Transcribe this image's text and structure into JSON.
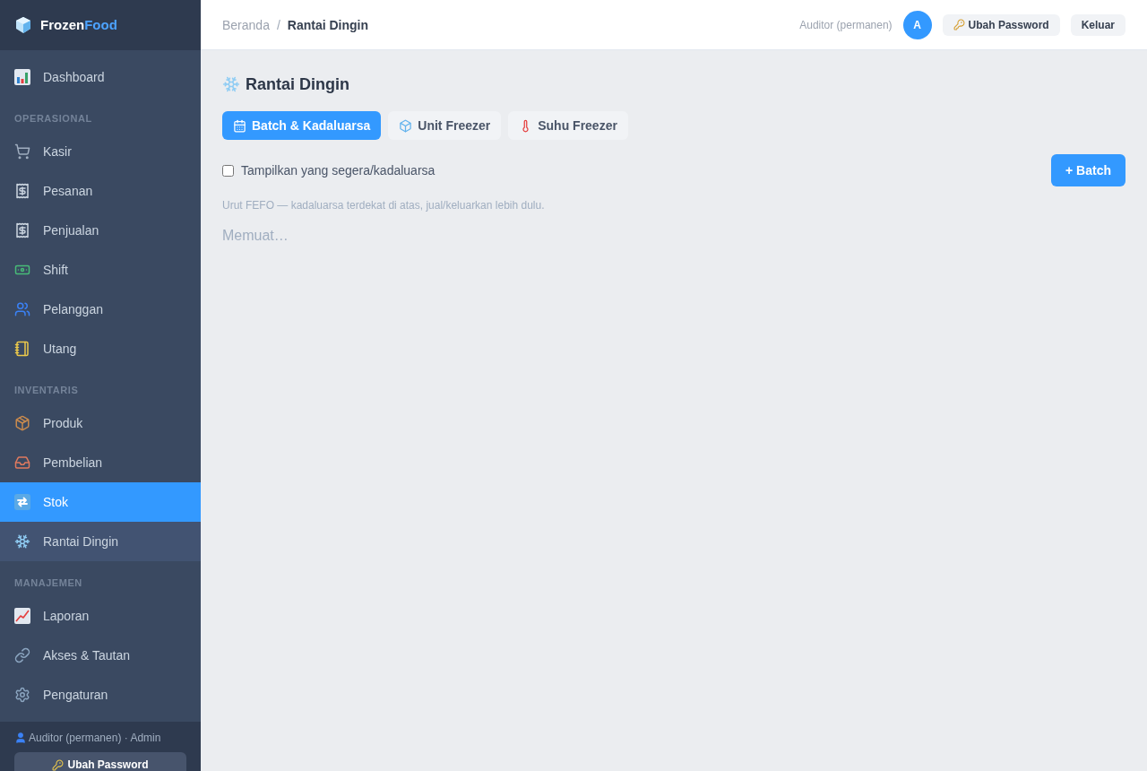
{
  "sidebar": {
    "brand": {
      "primary": "Frozen",
      "accent": "Food"
    },
    "items": [
      {
        "label": "Dashboard",
        "selected": false,
        "highlighted": false
      }
    ],
    "sections": [
      {
        "title": "OPERASIONAL",
        "items": [
          {
            "label": "Kasir",
            "selected": false,
            "highlighted": false
          },
          {
            "label": "Pesanan",
            "selected": false,
            "highlighted": false
          },
          {
            "label": "Penjualan",
            "selected": false,
            "highlighted": false
          },
          {
            "label": "Shift",
            "selected": false,
            "highlighted": false
          },
          {
            "label": "Pelanggan",
            "selected": false,
            "highlighted": false
          },
          {
            "label": "Utang",
            "selected": false,
            "highlighted": false
          }
        ]
      },
      {
        "title": "INVENTARIS",
        "items": [
          {
            "label": "Produk",
            "selected": false,
            "highlighted": false
          },
          {
            "label": "Pembelian",
            "selected": false,
            "highlighted": false
          },
          {
            "label": "Stok",
            "selected": true,
            "highlighted": false
          },
          {
            "label": "Rantai Dingin",
            "selected": false,
            "highlighted": true
          }
        ]
      },
      {
        "title": "MANAJEMEN",
        "items": [
          {
            "label": "Laporan",
            "selected": false,
            "highlighted": false
          },
          {
            "label": "Akses & Tautan",
            "selected": false,
            "highlighted": false
          },
          {
            "label": "Pengaturan",
            "selected": false,
            "highlighted": false
          }
        ]
      }
    ],
    "footer": {
      "user_line": "Auditor (permanen) · Admin",
      "button": "Ubah Password"
    }
  },
  "topbar": {
    "breadcrumb": {
      "separator": "/",
      "items": [
        {
          "label": "Beranda",
          "current": false
        },
        {
          "label": "Rantai Dingin",
          "current": true
        }
      ]
    },
    "user": {
      "name": "Auditor (permanen)",
      "avatar": "A"
    },
    "buttons": [
      "Ubah Password",
      "Keluar"
    ]
  },
  "page": {
    "title": "Rantai Dingin",
    "tabs": [
      {
        "label": "Batch & Kadaluarsa",
        "selected": true
      },
      {
        "label": "Unit Freezer",
        "selected": false
      },
      {
        "label": "Suhu Freezer",
        "selected": false
      }
    ],
    "filter": {
      "label": "Tampilkan yang segera/kadaluarsa",
      "checked": false
    },
    "add_button": "+ Batch",
    "hint": "Urut FEFO — kadaluarsa terdekat di atas, jual/keluarkan lebih dulu.",
    "loading": "Memuat…"
  }
}
